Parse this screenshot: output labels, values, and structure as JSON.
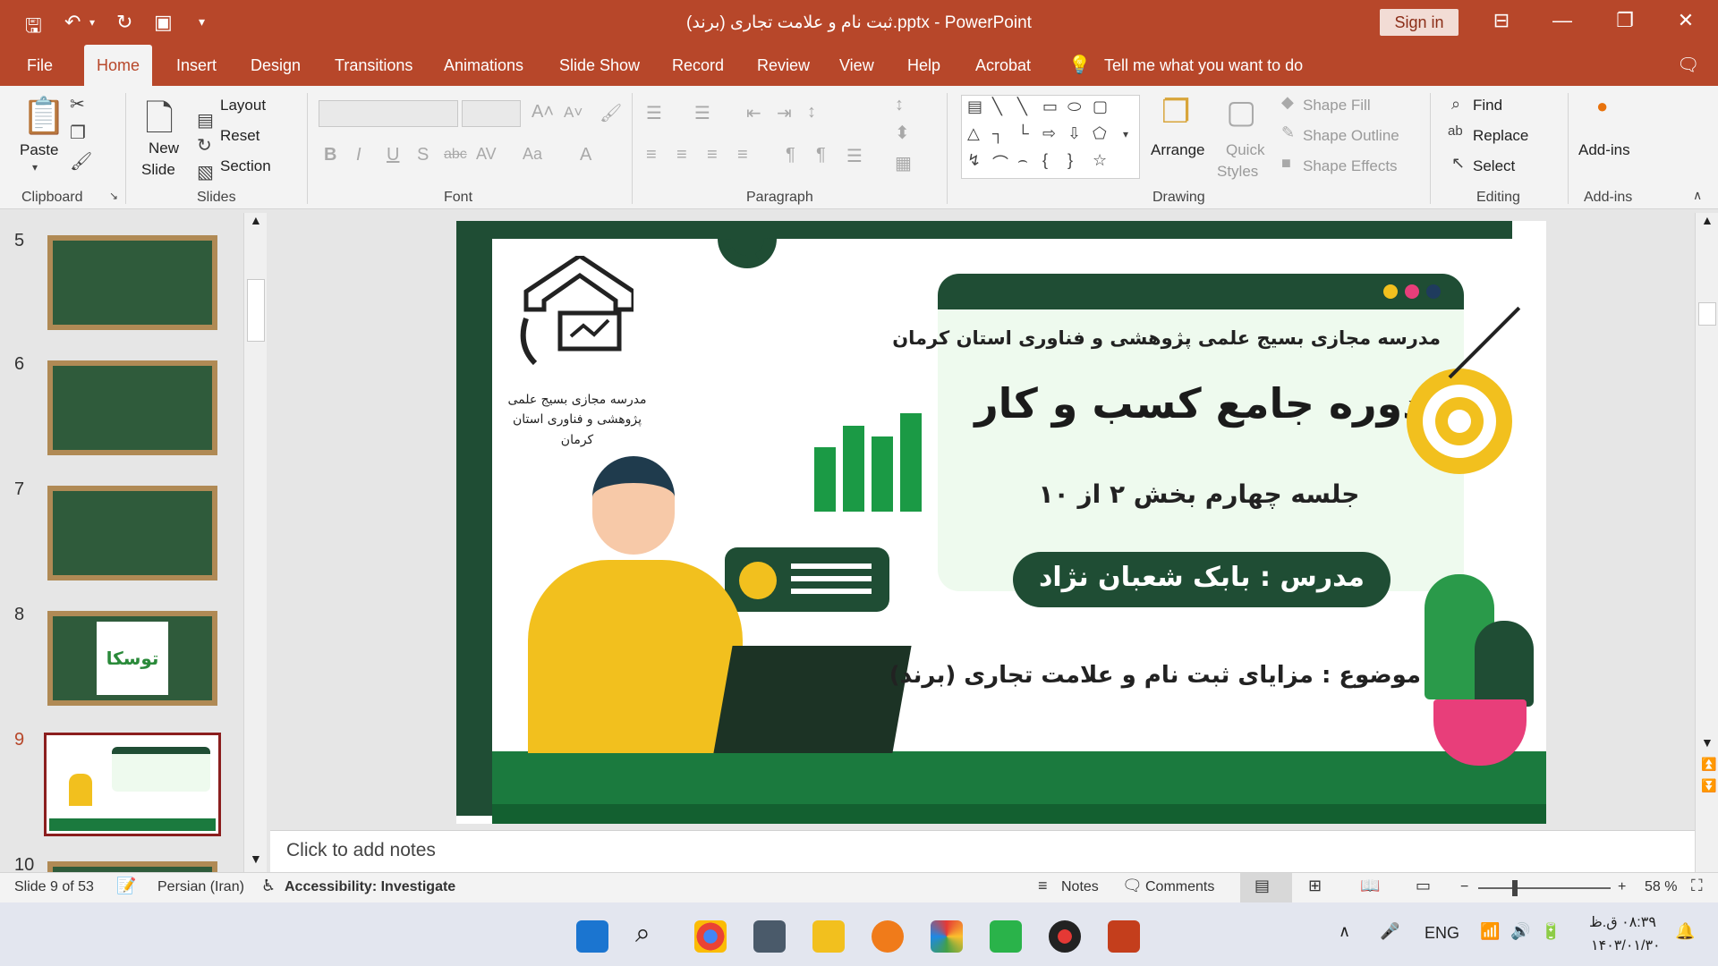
{
  "titlebar": {
    "title": "ثبت نام و علامت تجاری (برند).pptx  -  PowerPoint",
    "sign_in": "Sign in",
    "qa_icons": [
      "save-icon",
      "undo-icon",
      "redo-icon",
      "present-icon",
      "customize-icon"
    ]
  },
  "tabs": [
    "File",
    "Home",
    "Insert",
    "Design",
    "Transitions",
    "Animations",
    "Slide Show",
    "Record",
    "Review",
    "View",
    "Help",
    "Acrobat"
  ],
  "tell_me": "Tell me what you want to do",
  "ribbon": {
    "clipboard": {
      "paste": "Paste",
      "label": "Clipboard"
    },
    "slides": {
      "new_slide_1": "New",
      "new_slide_2": "Slide",
      "layout": "Layout",
      "reset": "Reset",
      "section": "Section",
      "label": "Slides"
    },
    "font": {
      "label": "Font",
      "bold": "B",
      "italic": "I",
      "underline": "U",
      "shadow": "S",
      "strike": "abc",
      "spacing": "AV",
      "case": "Aa",
      "color": "A"
    },
    "paragraph": {
      "label": "Paragraph"
    },
    "drawing": {
      "arrange": "Arrange",
      "quick_styles_1": "Quick",
      "quick_styles_2": "Styles",
      "shape_fill": "Shape Fill",
      "shape_outline": "Shape Outline",
      "shape_effects": "Shape Effects",
      "label": "Drawing"
    },
    "editing": {
      "find": "Find",
      "replace": "Replace",
      "select": "Select",
      "label": "Editing"
    },
    "addins": {
      "addins": "Add-ins",
      "label": "Add-ins"
    }
  },
  "thumbnails": [
    "5",
    "6",
    "7",
    "8",
    "9",
    "10"
  ],
  "thumbnail_8_text": "توسکا",
  "slide": {
    "school_name": "مدرسه مجازی بسیج علمی پژوهشی و فناوری استان کرمان",
    "course_title": "دوره جامع کسب و کار",
    "session": "جلسه چهارم بخش ۲ از ۱۰",
    "teacher": "مدرس : بابک شعبان نژاد",
    "topic": "موضوع :      مزایای ثبت نام و علامت تجاری (برند)",
    "logo_caption": "مدرسه مجازی بسیج علمی پژوهشی و فناوری استان کرمان",
    "colors": {
      "dark_green": "#1f4d34",
      "green": "#1b7a3e",
      "yellow": "#f2c01e",
      "pink": "#e83e7a"
    }
  },
  "notes_placeholder": "Click to add notes",
  "status": {
    "slide_count": "Slide 9 of 53",
    "language": "Persian (Iran)",
    "accessibility": "Accessibility: Investigate",
    "notes": "Notes",
    "comments": "Comments",
    "zoom": "58 %"
  },
  "taskbar": {
    "lang": "ENG",
    "time": "۰۸:۳۹ ق.ظ",
    "date": "۱۴۰۳/۰۱/۳۰"
  }
}
